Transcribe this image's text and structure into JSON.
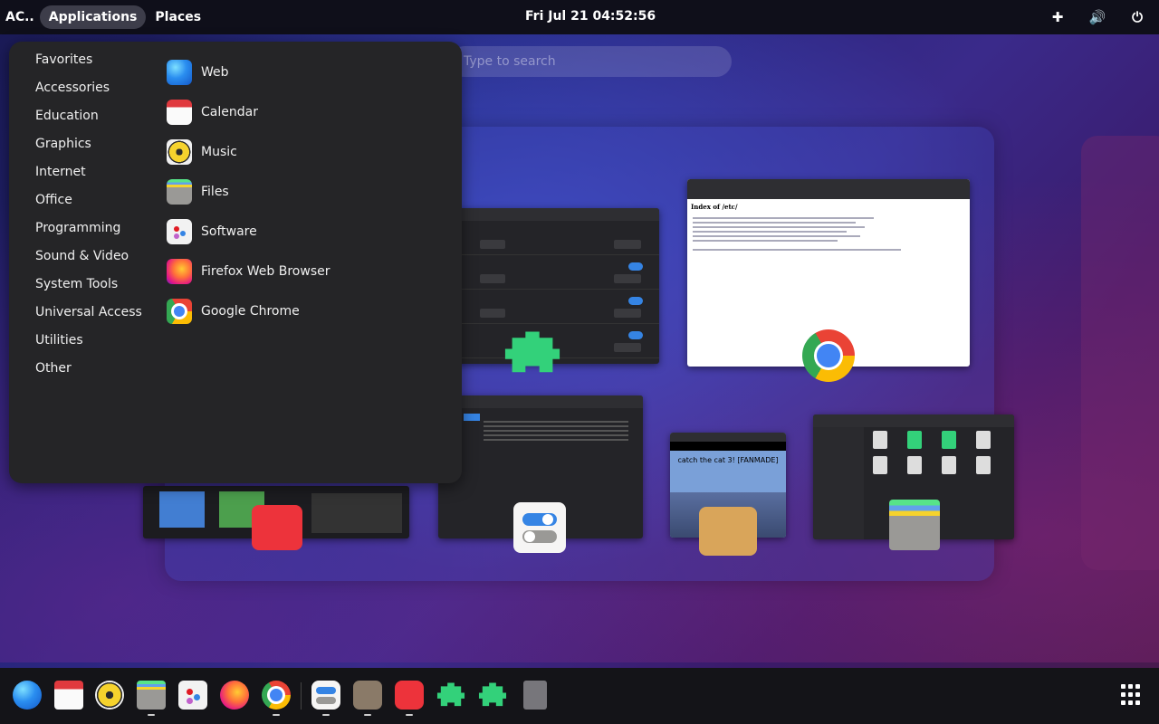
{
  "topbar": {
    "activities": "AC..",
    "applications": "Applications",
    "places": "Places",
    "clock": "Fri Jul 21  04:52:56",
    "tray": [
      {
        "name": "extensions-icon",
        "glyph": "✚"
      },
      {
        "name": "volume-icon",
        "glyph": "🔊"
      },
      {
        "name": "power-icon",
        "glyph": "⏻"
      }
    ]
  },
  "search": {
    "placeholder": "Type to search"
  },
  "apps_menu": {
    "categories": [
      "Favorites",
      "Accessories",
      "Education",
      "Graphics",
      "Internet",
      "Office",
      "Programming",
      "Sound & Video",
      "System Tools",
      "Universal Access",
      "Utilities",
      "Other"
    ],
    "apps": [
      {
        "label": "Web",
        "icon": "web-browser-icon"
      },
      {
        "label": "Calendar",
        "icon": "calendar-icon"
      },
      {
        "label": "Music",
        "icon": "music-icon"
      },
      {
        "label": "Files",
        "icon": "files-icon"
      },
      {
        "label": "Software",
        "icon": "software-icon"
      },
      {
        "label": "Firefox Web Browser",
        "icon": "firefox-icon"
      },
      {
        "label": "Google Chrome",
        "icon": "chrome-icon"
      }
    ]
  },
  "windows": {
    "browser_title": "Index of /etc/",
    "game_title": "catch the cat 3! [FANMADE]"
  },
  "dock": {
    "items": [
      "web-browser-icon",
      "calendar-icon",
      "music-icon",
      "files-icon",
      "software-icon",
      "firefox-icon",
      "chrome-icon",
      "settings-icon",
      "scratch-cat-icon",
      "text-editor-icon",
      "extensions-icon",
      "extension-manager-icon",
      "trash-icon"
    ]
  }
}
